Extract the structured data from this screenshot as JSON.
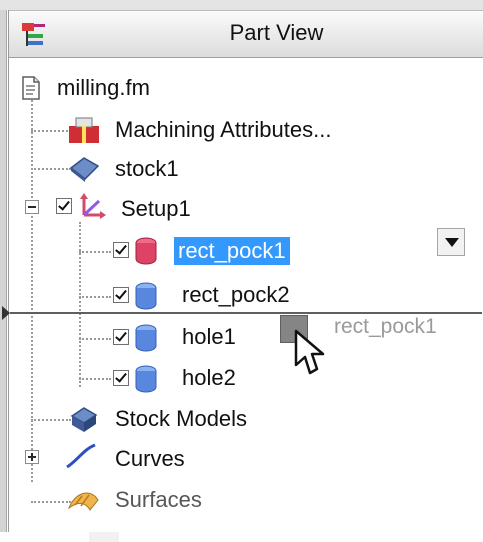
{
  "header": {
    "title": "Part View",
    "icon": "part-view-tree-icon"
  },
  "tree": {
    "file": {
      "label": "milling.fm",
      "icon": "document-icon"
    },
    "machining": {
      "label": "Machining Attributes...",
      "icon": "machining-attributes-icon"
    },
    "stock": {
      "label": "stock1",
      "icon": "stock-icon"
    },
    "setup": {
      "label": "Setup1",
      "icon": "setup-icon",
      "checked": true,
      "expanded": true
    },
    "features": [
      {
        "label": "rect_pock1",
        "icon": "feature-pocket-icon",
        "checked": true,
        "selected": true
      },
      {
        "label": "rect_pock2",
        "icon": "feature-pocket-icon",
        "checked": true
      },
      {
        "label": "hole1",
        "icon": "feature-hole-icon",
        "checked": true
      },
      {
        "label": "hole2",
        "icon": "feature-hole-icon",
        "checked": true
      }
    ],
    "stock_models": {
      "label": "Stock Models",
      "icon": "stock-models-icon"
    },
    "curves": {
      "label": "Curves",
      "icon": "curve-icon",
      "expanded": false
    },
    "surfaces": {
      "label": "Surfaces",
      "icon": "surface-icon"
    }
  },
  "drag": {
    "label": "rect_pock1",
    "icon": "drag-ghost-icon",
    "cursor": "pointer-cursor-icon"
  },
  "dropdown": {
    "icon": "dropdown-arrow-icon"
  },
  "colors": {
    "selection": "#3399ff",
    "header_gradient_top": "#fbfbfb",
    "header_gradient_bottom": "#dcdcdc"
  }
}
